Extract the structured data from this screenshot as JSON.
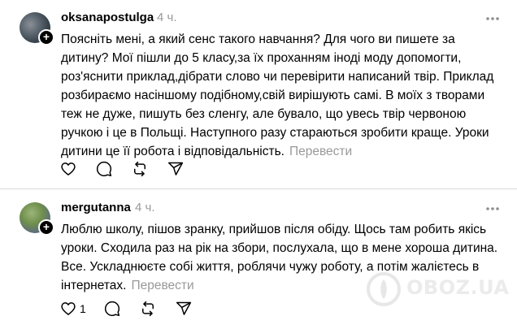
{
  "posts": [
    {
      "username": "oksanapostulga",
      "time": "4 ч.",
      "text": "Поясніть мені, а який сенс такого навчання? Для чого ви пишете за дитину? Мої пішли до 5 класу,за їх проханням іноді моду допомогти, роз'яснити приклад,дібрати слово чи перевірити написаний твір. Приклад розбираємо насіншому подібному,свій вирішують самі. В моїх з творами теж не дуже, пишуть без сленгу, але бувало, що увесь твір червоною ручкою і це в Польщі. Наступного разу стараються зробити краще. Уроки дитини це її робота і відповідальність.",
      "translate_label": "Перевести",
      "like_count": ""
    },
    {
      "username": "mergutanna",
      "time": "4 ч.",
      "text": "Люблю школу, пішов зранку, прийшов після обіду. Щось там робить якісь уроки. Сходила раз на рік на збори, послухала, що в мене хороша дитина. Все. Ускладнюєте собі життя, роблячи чужу роботу, а потім жалієтесь в інтернетах.",
      "translate_label": "Перевести",
      "like_count": "1"
    }
  ],
  "icons": {
    "more": "more-horizontal-icon",
    "like": "heart-icon",
    "reply": "comment-bubble-icon",
    "repost": "repost-icon",
    "share": "send-icon",
    "follow": "plus-icon"
  },
  "watermark": "OBOZ.UA",
  "colors": {
    "text": "#000000",
    "muted": "#999999",
    "divider": "#d9d9d9",
    "background": "#ffffff"
  }
}
